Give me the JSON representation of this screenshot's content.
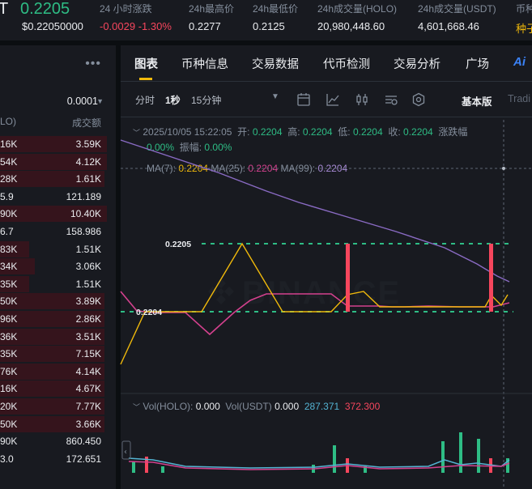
{
  "ticker": {
    "symbol": "T",
    "price": "0.2205",
    "price_usd": "$0.22050000",
    "stats": [
      {
        "label": "24 小时涨跌",
        "value": "-0.0029 -1.30%"
      },
      {
        "label": "24h最高价",
        "value": "0.2277"
      },
      {
        "label": "24h最低价",
        "value": "0.2125"
      },
      {
        "label": "24h成交量(HOLO)",
        "value": "20,980,448.60"
      },
      {
        "label": "24h成交量(USDT)",
        "value": "4,601,668.46"
      },
      {
        "label": "币种",
        "value": "种子"
      }
    ]
  },
  "order_book": {
    "more_icon": "more-dots-icon",
    "precision": "0.0001",
    "col_amount": "LO)",
    "col_total": "成交额",
    "rows": [
      {
        "amount": "16K",
        "total": "3.59K",
        "depth": 0.92
      },
      {
        "amount": "54K",
        "total": "4.12K",
        "depth": 0.92
      },
      {
        "amount": "28K",
        "total": "1.61K",
        "depth": 0.9
      },
      {
        "amount": "5.9",
        "total": "121.189",
        "depth": 0.0
      },
      {
        "amount": "90K",
        "total": "10.40K",
        "depth": 0.92
      },
      {
        "amount": "6.7",
        "total": "158.986",
        "depth": 0.0
      },
      {
        "amount": "83K",
        "total": "1.51K",
        "depth": 0.25
      },
      {
        "amount": "34K",
        "total": "3.06K",
        "depth": 0.3
      },
      {
        "amount": "35K",
        "total": "1.51K",
        "depth": 0.25
      },
      {
        "amount": "50K",
        "total": "3.89K",
        "depth": 0.9
      },
      {
        "amount": "96K",
        "total": "2.86K",
        "depth": 0.9
      },
      {
        "amount": "36K",
        "total": "3.51K",
        "depth": 0.9
      },
      {
        "amount": "35K",
        "total": "7.15K",
        "depth": 0.9
      },
      {
        "amount": "76K",
        "total": "4.14K",
        "depth": 0.9
      },
      {
        "amount": "16K",
        "total": "4.67K",
        "depth": 0.9
      },
      {
        "amount": "20K",
        "total": "7.77K",
        "depth": 0.9
      },
      {
        "amount": "50K",
        "total": "3.66K",
        "depth": 0.9
      },
      {
        "amount": "90K",
        "total": "860.450",
        "depth": 0.0
      },
      {
        "amount": "3.0",
        "total": "172.651",
        "depth": 0.0
      }
    ]
  },
  "chart_panel": {
    "tabs": [
      "图表",
      "币种信息",
      "交易数据",
      "代币检测",
      "交易分析",
      "广场"
    ],
    "ai_label": "Ai",
    "intervals": [
      "分时",
      "1秒",
      "15分钟"
    ],
    "active_interval": "1秒",
    "view_basic": "基本版",
    "view_trading": "Tradi",
    "candle_info": {
      "datetime": "2025/10/05 15:22:05",
      "open_label": "开:",
      "open": "0.2204",
      "high_label": "高:",
      "high": "0.2204",
      "low_label": "低:",
      "low": "0.2204",
      "close_label": "收:",
      "close": "0.2204",
      "change_label": "涨跌幅",
      "change": "0.00%",
      "amplitude_label": "振幅:",
      "amplitude": "0.00%"
    },
    "ma": [
      {
        "label": "MA(7):",
        "value": "0.2204",
        "color": "#f0b90b"
      },
      {
        "label": "MA(25):",
        "value": "0.2204",
        "color": "#d4418e"
      },
      {
        "label": "MA(99):",
        "value": "0.2204",
        "color": "#a88bd6"
      }
    ],
    "volume": {
      "holo_label": "Vol(HOLO):",
      "holo": "0.000",
      "usdt_label": "Vol(USDT)",
      "usdt": "0.000",
      "ma1": "287.371",
      "ma2": "372.300"
    },
    "watermark": "BINANCE",
    "price_high_label": "0.2205",
    "price_low_label": "0.2204"
  }
}
